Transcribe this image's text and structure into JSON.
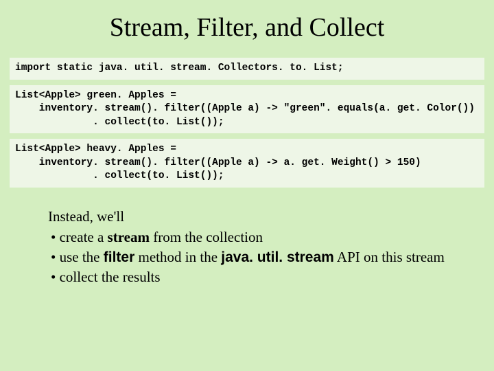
{
  "title": "Stream, Filter, and Collect",
  "code": {
    "block1": "import static java. util. stream. Collectors. to. List;",
    "block2": "List<Apple> green. Apples =\n    inventory. stream(). filter((Apple a) -> \"green\". equals(a. get. Color())\n             . collect(to. List());",
    "block3": "List<Apple> heavy. Apples =\n    inventory. stream(). filter((Apple a) -> a. get. Weight() > 150)\n             . collect(to. List());"
  },
  "body": {
    "intro": "Instead, we'll",
    "bullets": {
      "b1_pre": "create a ",
      "b1_bold": "stream",
      "b1_post": " from the collection",
      "b2_pre": "use the ",
      "b2_bold1": "filter",
      "b2_mid": " method in the ",
      "b2_bold2": "java. util. stream",
      "b2_post": " API on this stream",
      "b3": "collect the results"
    }
  }
}
